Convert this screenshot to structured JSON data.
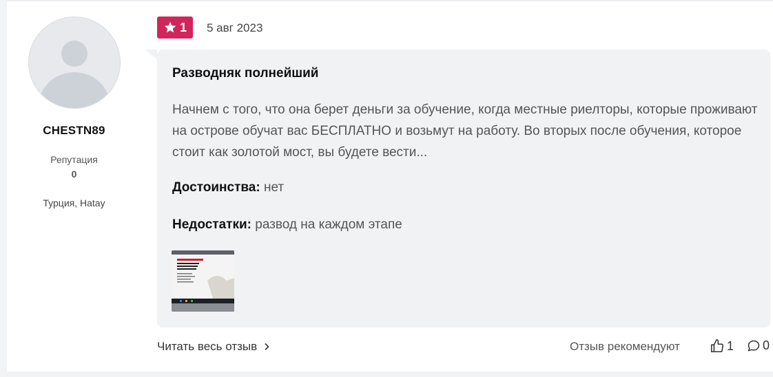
{
  "author": {
    "username": "CHESTN89",
    "reputation_label": "Репутация",
    "reputation_value": "0",
    "location": "Турция, Hatay"
  },
  "review": {
    "rating": "1",
    "date": "5 авг 2023",
    "title": "Разводняк полнейший",
    "text": "Начнем с того, что она берет деньги за обучение, когда местные риелторы, которые проживают на острове обучат вас БЕСПЛАТНО и возьмут на работу. Во вторых после обучения, которое стоит как золотой мост, вы будете вести...",
    "pros_label": "Достоинства:",
    "pros_value": "нет",
    "cons_label": "Недостатки:",
    "cons_value": "развод на каждом этапе"
  },
  "footer": {
    "read_more": "Читать весь отзыв",
    "recommend_label": "Отзыв рекомендуют",
    "likes": "1",
    "comments": "0"
  },
  "colors": {
    "rating_badge": "#d0265a",
    "bubble_bg": "#f1f2f4"
  },
  "icons": [
    "star-icon",
    "chevron-right-icon",
    "thumbs-up-icon",
    "comment-icon",
    "avatar-placeholder-icon"
  ]
}
